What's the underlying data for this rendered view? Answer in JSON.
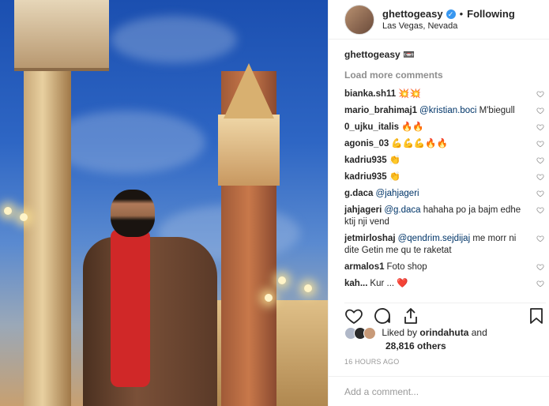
{
  "header": {
    "username": "ghettogeasy",
    "follow_state": "Following",
    "separator": "•",
    "location": "Las Vegas, Nevada"
  },
  "caption": {
    "username": "ghettogeasy",
    "text": "📼"
  },
  "load_more": "Load more comments",
  "comments": [
    {
      "user": "bianka.sh11",
      "text": "💥💥",
      "mention": ""
    },
    {
      "user": "mario_brahimaj1",
      "mention": "@kristian.boci",
      "text": "M'biegull"
    },
    {
      "user": "0_ujku_italis",
      "mention": "",
      "text": "🔥🔥"
    },
    {
      "user": "agonis_03",
      "mention": "",
      "text": "💪💪💪🔥🔥"
    },
    {
      "user": "kadriu935",
      "mention": "",
      "text": "👏"
    },
    {
      "user": "kadriu935",
      "mention": "",
      "text": "👏"
    },
    {
      "user": "g.daca",
      "mention": "@jahjageri",
      "text": ""
    },
    {
      "user": "jahjageri",
      "mention": "@g.daca",
      "text": "hahaha po ja bajm edhe ktij nji vend"
    },
    {
      "user": "jetmirloshaj",
      "mention": "@qendrim.sejdijaj",
      "text": "me morr ni dite Getin me qu te raketat"
    },
    {
      "user": "armalos1",
      "mention": "",
      "text": "Foto shop"
    },
    {
      "user": "kah...",
      "mention": "",
      "text": "Kur ... ❤️"
    }
  ],
  "likes": {
    "prefix": "Liked by",
    "user": "orindahuta",
    "and": "and",
    "count": "28,816 others"
  },
  "timestamp": "16 HOURS AGO",
  "add_comment_placeholder": "Add a comment...",
  "icons": {
    "like": "heart-icon",
    "comment": "comment-icon",
    "share": "share-icon",
    "save": "bookmark-icon",
    "verified": "verified-badge-icon"
  },
  "colors": {
    "verified": "#3897f0",
    "mention": "#003569",
    "muted": "#8e8e8e"
  }
}
